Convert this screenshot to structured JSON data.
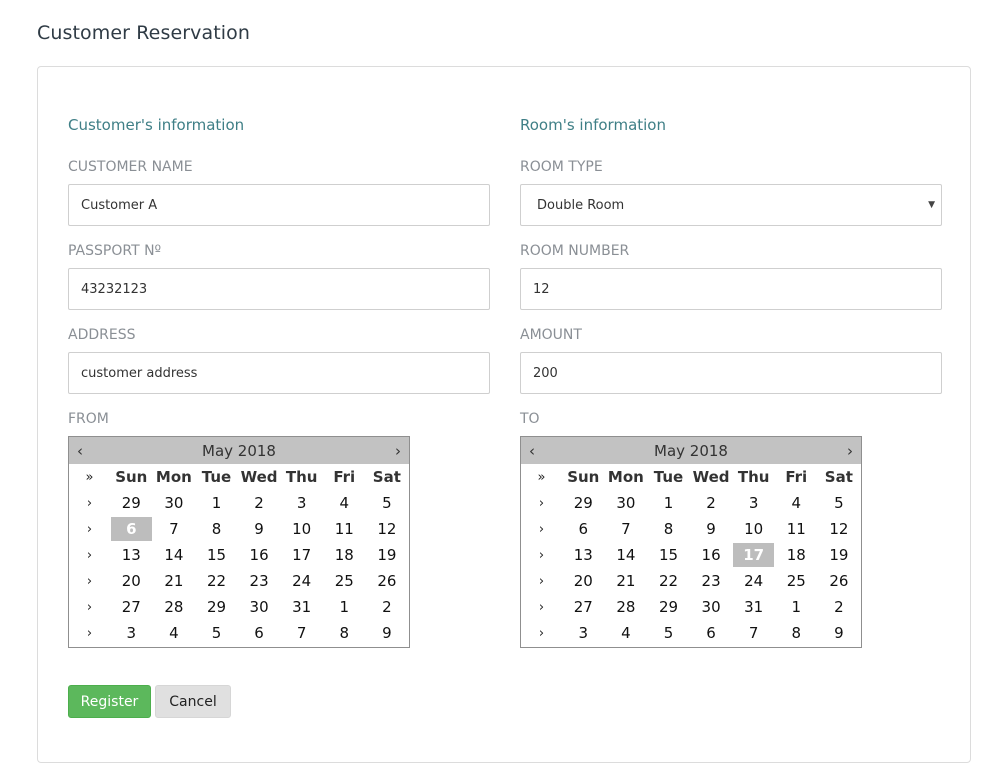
{
  "page": {
    "title": "Customer Reservation"
  },
  "customer": {
    "section_title": "Customer's information",
    "name_label": "CUSTOMER NAME",
    "name_value": "Customer A",
    "passport_label": "PASSPORT Nº",
    "passport_value": "43232123",
    "address_label": "ADDRESS",
    "address_value": "customer address",
    "from_label": "FROM"
  },
  "room": {
    "section_title": "Room's information",
    "type_label": "ROOM TYPE",
    "type_value": "Double Room",
    "number_label": "ROOM NUMBER",
    "number_value": "12",
    "amount_label": "AMOUNT",
    "amount_value": "200",
    "to_label": "TO"
  },
  "calendar_common": {
    "prev": "‹",
    "next": "›",
    "week_all": "»",
    "week_marker": "›",
    "days_of_week": [
      "Sun",
      "Mon",
      "Tue",
      "Wed",
      "Thu",
      "Fri",
      "Sat"
    ],
    "weeks": [
      [
        "29",
        "30",
        "1",
        "2",
        "3",
        "4",
        "5"
      ],
      [
        "6",
        "7",
        "8",
        "9",
        "10",
        "11",
        "12"
      ],
      [
        "13",
        "14",
        "15",
        "16",
        "17",
        "18",
        "19"
      ],
      [
        "20",
        "21",
        "22",
        "23",
        "24",
        "25",
        "26"
      ],
      [
        "27",
        "28",
        "29",
        "30",
        "31",
        "1",
        "2"
      ],
      [
        "3",
        "4",
        "5",
        "6",
        "7",
        "8",
        "9"
      ]
    ]
  },
  "from_calendar": {
    "month": "May 2018",
    "selected": "6",
    "selected_week": 1
  },
  "to_calendar": {
    "month": "May 2018",
    "selected": "17",
    "selected_week": 2
  },
  "actions": {
    "register_label": "Register",
    "cancel_label": "Cancel"
  }
}
